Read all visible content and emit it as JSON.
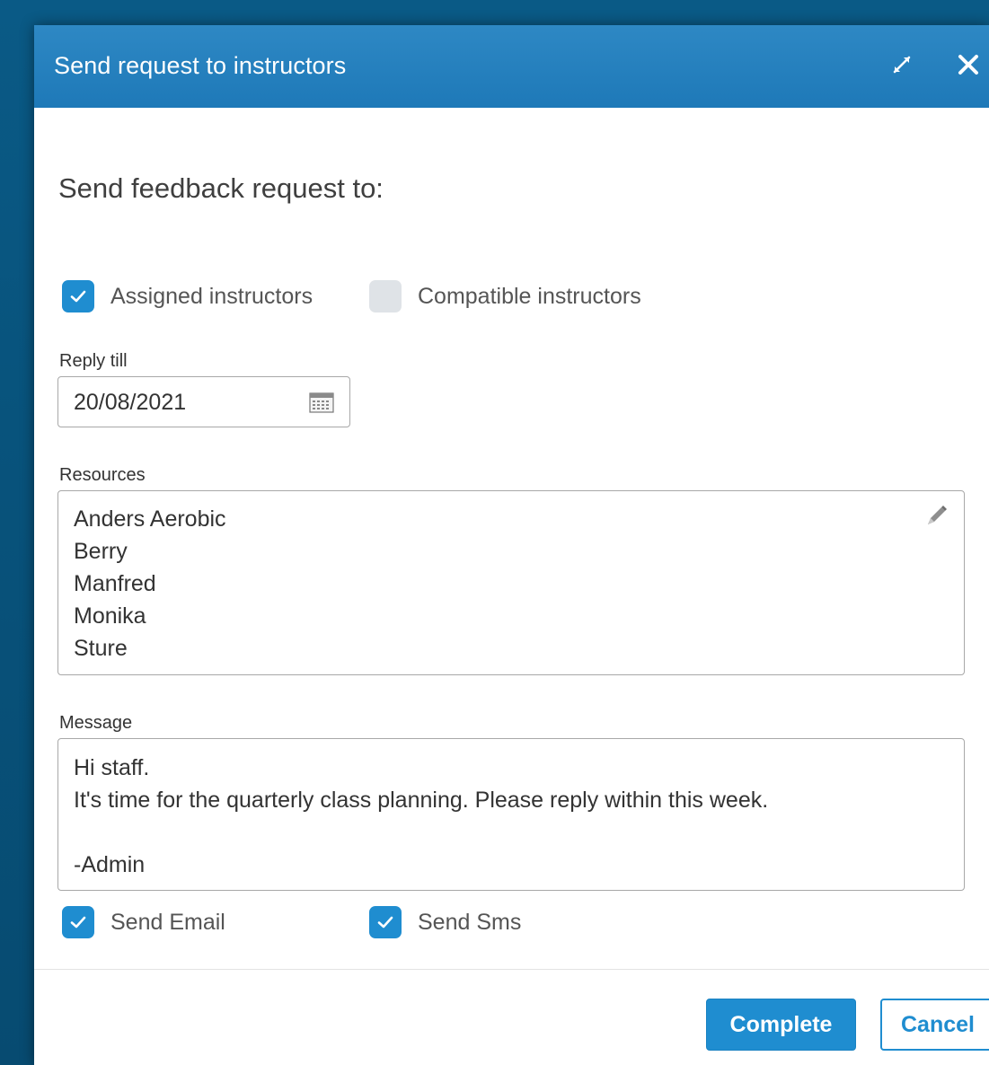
{
  "dialog": {
    "title": "Send request to instructors",
    "icons": {
      "expand": "expand-icon",
      "close": "close-icon"
    }
  },
  "form": {
    "heading": "Send feedback request to:",
    "recipients": [
      {
        "label": "Assigned instructors",
        "checked": true
      },
      {
        "label": "Compatible instructors",
        "checked": false
      }
    ],
    "reply_till": {
      "label": "Reply till",
      "value": "20/08/2021",
      "icon": "calendar-icon"
    },
    "resources": {
      "label": "Resources",
      "items": [
        "Anders Aerobic",
        "Berry",
        "Manfred",
        "Monika",
        "Sture"
      ],
      "icon": "pencil-icon"
    },
    "message": {
      "label": "Message",
      "lines": [
        "Hi staff.",
        "It's time for the quarterly class planning. Please reply within this week.",
        "",
        "-Admin"
      ]
    },
    "send_options": [
      {
        "label": "Send Email",
        "checked": true
      },
      {
        "label": "Send Sms",
        "checked": true
      }
    ]
  },
  "footer": {
    "complete_label": "Complete",
    "cancel_label": "Cancel"
  },
  "colors": {
    "accent": "#1f8dd0",
    "titlebar": "#2381bf",
    "background": "#08537c"
  }
}
